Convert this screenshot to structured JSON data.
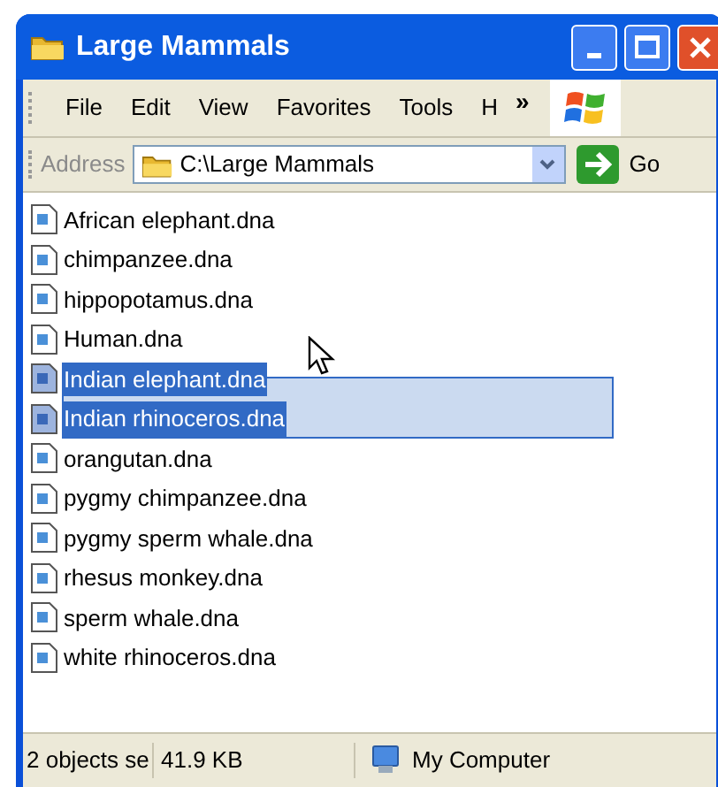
{
  "window": {
    "title": "Large Mammals"
  },
  "menu": [
    "File",
    "Edit",
    "View",
    "Favorites",
    "Tools",
    "H"
  ],
  "menu_overflow": "»",
  "address": {
    "label": "Address",
    "value": "C:\\Large Mammals",
    "go": "Go"
  },
  "files": [
    {
      "name": "African elephant.dna",
      "selected": false
    },
    {
      "name": "chimpanzee.dna",
      "selected": false
    },
    {
      "name": "hippopotamus.dna",
      "selected": false
    },
    {
      "name": "Human.dna",
      "selected": false
    },
    {
      "name": "Indian elephant.dna",
      "selected": true
    },
    {
      "name": "Indian rhinoceros.dna",
      "selected": true
    },
    {
      "name": "orangutan.dna",
      "selected": false
    },
    {
      "name": "pygmy chimpanzee.dna",
      "selected": false
    },
    {
      "name": "pygmy sperm whale.dna",
      "selected": false
    },
    {
      "name": "rhesus monkey.dna",
      "selected": false
    },
    {
      "name": "sperm whale.dna",
      "selected": false
    },
    {
      "name": "white rhinoceros.dna",
      "selected": false
    }
  ],
  "status_bar": {
    "selection": "2 objects se",
    "size": "41.9 KB",
    "zone": "My Computer"
  }
}
